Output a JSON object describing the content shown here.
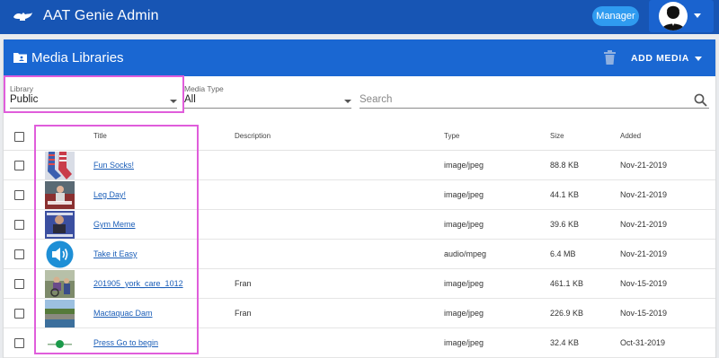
{
  "app": {
    "title": "AAT Genie Admin",
    "role": "Manager",
    "logo_icon": "genie-lamp-icon",
    "colors": {
      "appbar": "#1755b4",
      "header": "#1a67d2",
      "chip": "#2f9bf0",
      "link": "#1b5eb8",
      "highlight": "#e05ddb"
    }
  },
  "header": {
    "title": "Media Libraries",
    "icon": "folder-icon",
    "delete_icon": "trash-icon",
    "add_media_label": "ADD MEDIA"
  },
  "filters": {
    "library": {
      "label": "Library",
      "value": "Public"
    },
    "media_type": {
      "label": "Media Type",
      "value": "All"
    },
    "search": {
      "placeholder": "Search"
    }
  },
  "table": {
    "columns": {
      "title": "Title",
      "description": "Description",
      "type": "Type",
      "size": "Size",
      "added": "Added"
    },
    "rows": [
      {
        "title": "Fun Socks!",
        "description": "",
        "type": "image/jpeg",
        "size": "88.8 KB",
        "added": "Nov-21-2019",
        "thumb": "socks"
      },
      {
        "title": "Leg Day!",
        "description": "",
        "type": "image/jpeg",
        "size": "44.1 KB",
        "added": "Nov-21-2019",
        "thumb": "legday"
      },
      {
        "title": "Gym Meme",
        "description": "",
        "type": "image/jpeg",
        "size": "39.6 KB",
        "added": "Nov-21-2019",
        "thumb": "gym"
      },
      {
        "title": "Take it Easy",
        "description": "",
        "type": "audio/mpeg",
        "size": "6.4 MB",
        "added": "Nov-21-2019",
        "thumb": "audio"
      },
      {
        "title": "201905_york_care_1012",
        "description": "Fran",
        "type": "image/jpeg",
        "size": "461.1 KB",
        "added": "Nov-15-2019",
        "thumb": "york"
      },
      {
        "title": "Mactaquac Dam",
        "description": "Fran",
        "type": "image/jpeg",
        "size": "226.9 KB",
        "added": "Nov-15-2019",
        "thumb": "dam"
      },
      {
        "title": "Press Go to begin",
        "description": "",
        "type": "image/jpeg",
        "size": "32.4 KB",
        "added": "Oct-31-2019",
        "thumb": "go"
      }
    ]
  }
}
